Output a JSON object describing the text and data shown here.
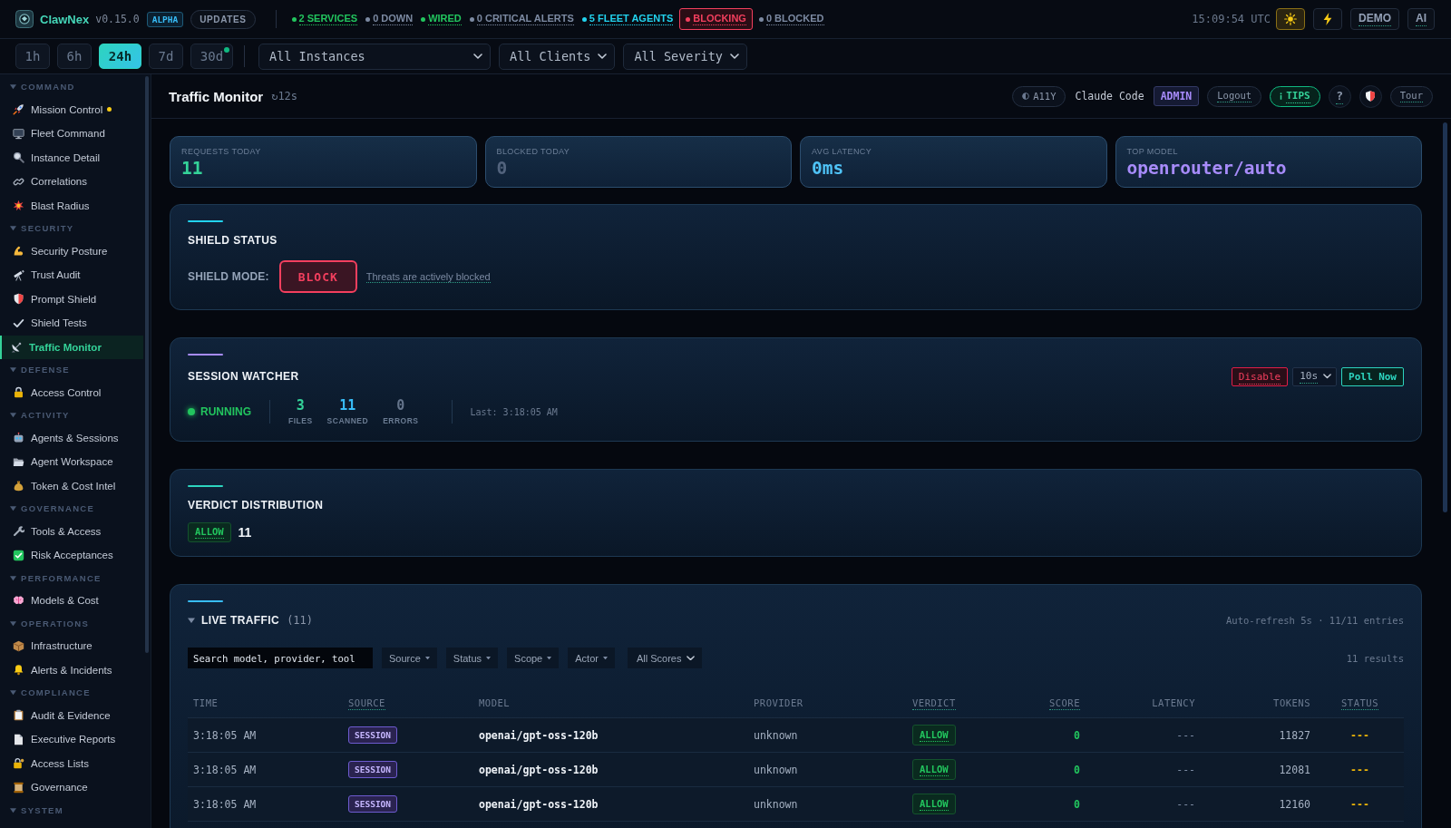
{
  "app": {
    "name": "ClawNex",
    "version": "v0.15.0",
    "badge": "ALPHA",
    "updates": "UPDATES"
  },
  "status_items": [
    {
      "kind": "indicator",
      "label": "2 SERVICES",
      "color": "#22c55e"
    },
    {
      "kind": "indicator",
      "label": "0 DOWN",
      "color": "#7c8aa2"
    },
    {
      "kind": "indicator",
      "label": "WIRED",
      "color": "#22c55e"
    },
    {
      "kind": "indicator",
      "label": "0 CRITICAL ALERTS",
      "color": "#7c8aa2"
    },
    {
      "kind": "indicator",
      "label": "5 FLEET AGENTS",
      "color": "#22d3ee"
    },
    {
      "kind": "alert",
      "label": "BLOCKING",
      "color": "#f43f5e"
    },
    {
      "kind": "indicator",
      "label": "0 BLOCKED",
      "color": "#7c8aa2"
    }
  ],
  "clock": "15:09:54 UTC",
  "top_buttons": [
    {
      "label": "DEMO"
    },
    {
      "label": "AI"
    }
  ],
  "time_ranges": [
    {
      "label": "1h",
      "selected": false,
      "indicator": false
    },
    {
      "label": "6h",
      "selected": false,
      "indicator": false
    },
    {
      "label": "24h",
      "selected": true,
      "indicator": false
    },
    {
      "label": "7d",
      "selected": false,
      "indicator": false
    },
    {
      "label": "30d",
      "selected": false,
      "indicator": true
    }
  ],
  "scope_filters": [
    {
      "value": "All Instances"
    },
    {
      "value": "All Clients"
    },
    {
      "value": "All Severity"
    }
  ],
  "sidebar": {
    "sections": [
      {
        "title": "COMMAND",
        "expanded": true,
        "items": [
          {
            "label": "Mission Control",
            "selected": false,
            "notice": true
          },
          {
            "label": "Fleet Command",
            "selected": false,
            "notice": false
          },
          {
            "label": "Instance Detail",
            "selected": false,
            "notice": false
          },
          {
            "label": "Correlations",
            "selected": false,
            "notice": false
          },
          {
            "label": "Blast Radius",
            "selected": false,
            "notice": false
          }
        ]
      },
      {
        "title": "SECURITY",
        "expanded": true,
        "items": [
          {
            "label": "Security Posture",
            "selected": false,
            "notice": false
          },
          {
            "label": "Trust Audit",
            "selected": false,
            "notice": false
          },
          {
            "label": "Prompt Shield",
            "selected": false,
            "notice": false
          },
          {
            "label": "Shield Tests",
            "selected": false,
            "notice": false
          },
          {
            "label": "Traffic Monitor",
            "selected": true,
            "notice": false
          }
        ]
      },
      {
        "title": "DEFENSE",
        "expanded": true,
        "items": [
          {
            "label": "Access Control",
            "selected": false,
            "notice": false
          }
        ]
      },
      {
        "title": "ACTIVITY",
        "expanded": true,
        "items": [
          {
            "label": "Agents & Sessions",
            "selected": false,
            "notice": false
          },
          {
            "label": "Agent Workspace",
            "selected": false,
            "notice": false
          },
          {
            "label": "Token & Cost Intel",
            "selected": false,
            "notice": false
          }
        ]
      },
      {
        "title": "GOVERNANCE",
        "expanded": true,
        "items": [
          {
            "label": "Tools & Access",
            "selected": false,
            "notice": false
          },
          {
            "label": "Risk Acceptances",
            "selected": false,
            "notice": false
          }
        ]
      },
      {
        "title": "PERFORMANCE",
        "expanded": true,
        "items": [
          {
            "label": "Models & Cost",
            "selected": false,
            "notice": false
          }
        ]
      },
      {
        "title": "OPERATIONS",
        "expanded": true,
        "items": [
          {
            "label": "Infrastructure",
            "selected": false,
            "notice": false
          },
          {
            "label": "Alerts & Incidents",
            "selected": false,
            "notice": false
          }
        ]
      },
      {
        "title": "COMPLIANCE",
        "expanded": true,
        "items": [
          {
            "label": "Audit & Evidence",
            "selected": false,
            "notice": false
          },
          {
            "label": "Executive Reports",
            "selected": false,
            "notice": false
          },
          {
            "label": "Access Lists",
            "selected": false,
            "notice": false
          },
          {
            "label": "Governance",
            "selected": false,
            "notice": false
          }
        ]
      },
      {
        "title": "SYSTEM",
        "expanded": true
      }
    ]
  },
  "page": {
    "title": "Traffic Monitor",
    "refresh": "↻12s"
  },
  "header": {
    "a11y": "A11Y",
    "client": "Claude Code",
    "role": "ADMIN",
    "logout": "Logout",
    "tips": "TIPS",
    "help": "?",
    "tour": "Tour"
  },
  "stats": [
    {
      "label": "REQUESTS TODAY",
      "value": "11",
      "color": "#34d399"
    },
    {
      "label": "BLOCKED TODAY",
      "value": "0",
      "color": "#52637d"
    },
    {
      "label": "AVG LATENCY",
      "value": "0ms",
      "color": "#4fc3f7"
    },
    {
      "label": "TOP MODEL",
      "value": "openrouter/auto",
      "color": "#a78bfa"
    }
  ],
  "shield": {
    "title": "SHIELD STATUS",
    "mode_label": "SHIELD MODE:",
    "mode": "BLOCK",
    "description": "Threats are actively blocked"
  },
  "session_watcher": {
    "title": "SESSION WATCHER",
    "running": true,
    "state": "RUNNING",
    "stats": [
      {
        "value": "3",
        "label": "FILES",
        "color": "#34d399"
      },
      {
        "value": "11",
        "label": "SCANNED",
        "color": "#38bdf8"
      },
      {
        "value": "0",
        "label": "ERRORS",
        "color": "#64748b"
      }
    ],
    "last_poll": "Last: 3:18:05 AM",
    "disable": "Disable",
    "interval": "10s",
    "poll": "Poll Now"
  },
  "verdict_distribution": {
    "title": "VERDICT DISTRIBUTION",
    "items": [
      {
        "verdict": "ALLOW",
        "count": "11"
      }
    ]
  },
  "live_traffic": {
    "title": "LIVE TRAFFIC",
    "count": "(11)",
    "expanded": true,
    "summary": "Auto-refresh 5s · 11/11 entries",
    "search": {
      "placeholder": "Search model, provider, tool"
    },
    "filters": [
      "Source",
      "Status",
      "Scope",
      "Actor"
    ],
    "score_filter": "All Scores",
    "results": "11 results",
    "table": {
      "columns": [
        {
          "label": "TIME",
          "tooltip": false
        },
        {
          "label": "SOURCE",
          "tooltip": true
        },
        {
          "label": "MODEL",
          "tooltip": false
        },
        {
          "label": "PROVIDER",
          "tooltip": false
        },
        {
          "label": "VERDICT",
          "tooltip": true
        },
        {
          "label": "SCORE",
          "tooltip": true
        },
        {
          "label": "LATENCY",
          "tooltip": false
        },
        {
          "label": "TOKENS",
          "tooltip": false
        },
        {
          "label": "STATUS",
          "tooltip": true
        }
      ],
      "rows": [
        {
          "time": "3:18:05 AM",
          "source": "SESSION",
          "model": "openai/gpt-oss-120b",
          "provider": "unknown",
          "verdict": "ALLOW",
          "score": "0",
          "latency": "---",
          "tokens": "11827",
          "status": "---"
        },
        {
          "time": "3:18:05 AM",
          "source": "SESSION",
          "model": "openai/gpt-oss-120b",
          "provider": "unknown",
          "verdict": "ALLOW",
          "score": "0",
          "latency": "---",
          "tokens": "12081",
          "status": "---"
        },
        {
          "time": "3:18:05 AM",
          "source": "SESSION",
          "model": "openai/gpt-oss-120b",
          "provider": "unknown",
          "verdict": "ALLOW",
          "score": "0",
          "latency": "---",
          "tokens": "12160",
          "status": "---"
        }
      ]
    }
  }
}
